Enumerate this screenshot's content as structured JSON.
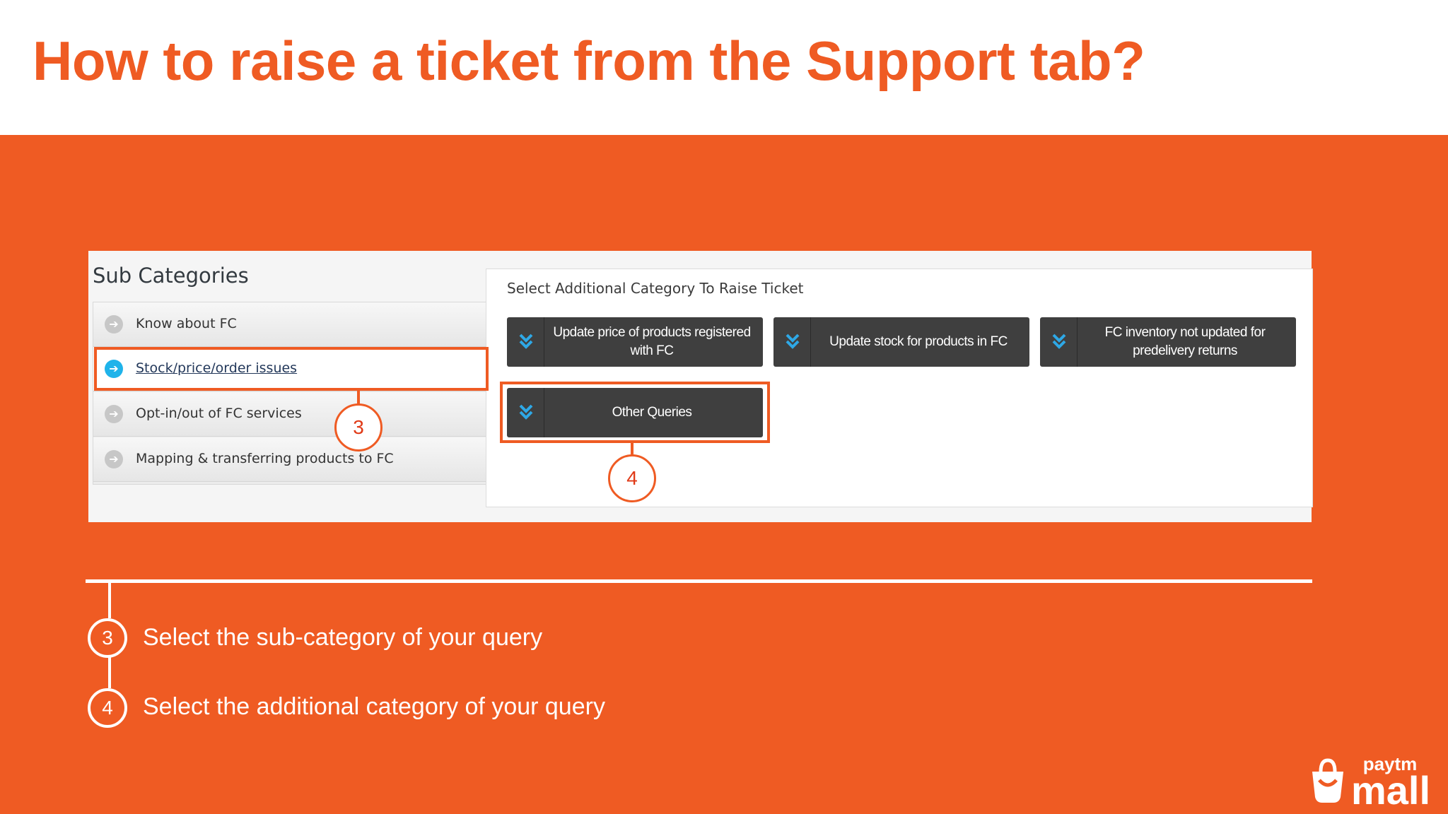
{
  "slide": {
    "title": "How to raise a ticket from the Support tab?"
  },
  "screenshot": {
    "sub_categories": {
      "heading": "Sub Categories",
      "items": [
        {
          "label": "Know about FC",
          "active": false
        },
        {
          "label": "Stock/price/order issues",
          "active": true
        },
        {
          "label": "Opt-in/out of FC services",
          "active": false
        },
        {
          "label": "Mapping & transferring products to FC",
          "active": false
        }
      ]
    },
    "additional": {
      "heading": "Select Additional Category To Raise Ticket",
      "buttons": [
        {
          "label": "Update price of products registered with FC"
        },
        {
          "label": "Update stock for products in FC"
        },
        {
          "label": "FC inventory not updated for predelivery returns"
        },
        {
          "label": "Other Queries"
        }
      ]
    },
    "callouts": [
      "3",
      "4"
    ]
  },
  "steps": [
    {
      "number": "3",
      "text": "Select the sub-category of your query"
    },
    {
      "number": "4",
      "text": "Select the additional category of your query"
    }
  ],
  "logo": {
    "top": "paytm",
    "bottom": "mall"
  },
  "colors": {
    "accent": "#ef5b23",
    "button": "#3f3f3f",
    "active_icon": "#1fb3ea"
  }
}
